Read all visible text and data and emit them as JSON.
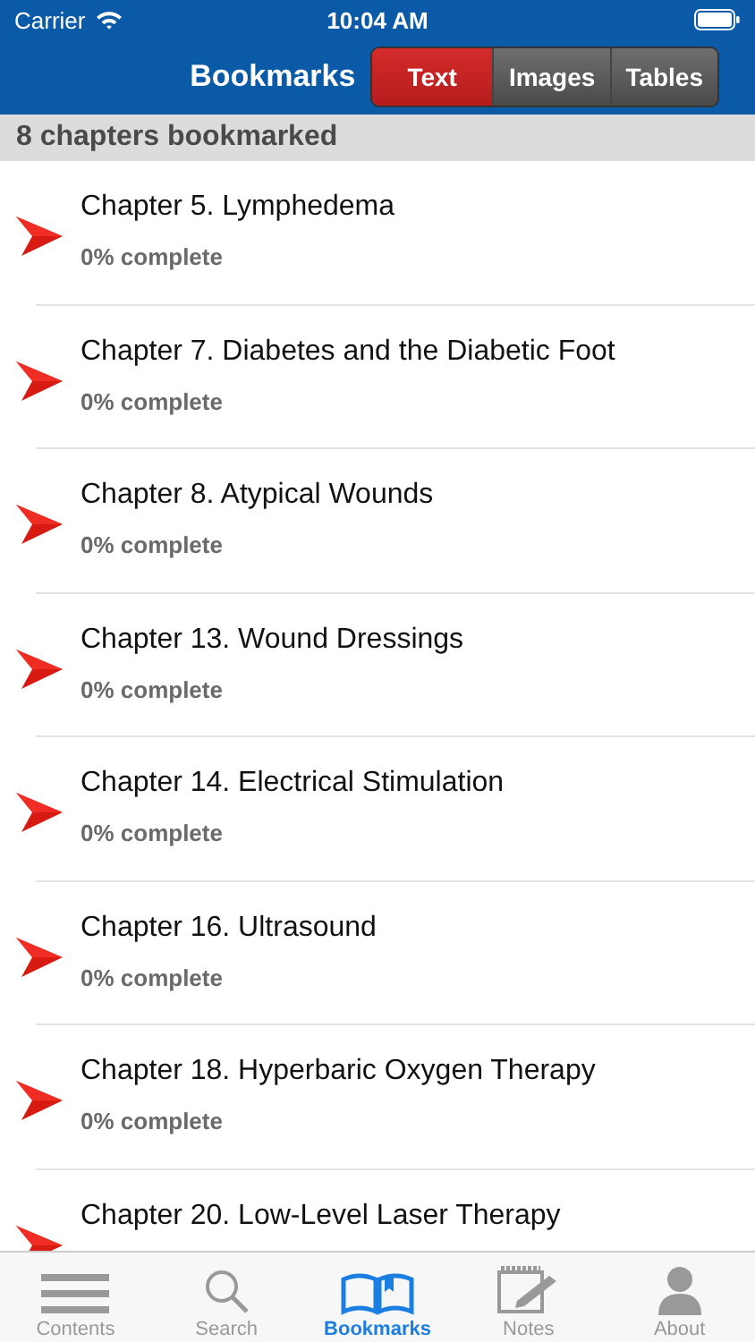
{
  "status_bar": {
    "carrier": "Carrier",
    "time": "10:04 AM"
  },
  "nav": {
    "title": "Bookmarks",
    "segments": [
      {
        "label": "Text",
        "selected": true
      },
      {
        "label": "Images",
        "selected": false
      },
      {
        "label": "Tables",
        "selected": false
      }
    ]
  },
  "header": "8 chapters bookmarked",
  "chapters": [
    {
      "title": "Chapter 5. Lymphedema",
      "progress": "0% complete"
    },
    {
      "title": "Chapter 7. Diabetes and the Diabetic Foot",
      "progress": "0% complete"
    },
    {
      "title": "Chapter 8. Atypical Wounds",
      "progress": "0% complete"
    },
    {
      "title": "Chapter 13. Wound Dressings",
      "progress": "0% complete"
    },
    {
      "title": "Chapter 14. Electrical Stimulation",
      "progress": "0% complete"
    },
    {
      "title": "Chapter 16. Ultrasound",
      "progress": "0% complete"
    },
    {
      "title": "Chapter 18. Hyperbaric Oxygen Therapy",
      "progress": "0% complete"
    },
    {
      "title": "Chapter 20. Low-Level Laser Therapy"
    }
  ],
  "tab_bar": [
    {
      "label": "Contents",
      "kind": "contents",
      "selected": false
    },
    {
      "label": "Search",
      "kind": "search",
      "selected": false
    },
    {
      "label": "Bookmarks",
      "kind": "bookmarks",
      "selected": true
    },
    {
      "label": "Notes",
      "kind": "notes",
      "selected": false
    },
    {
      "label": "About",
      "kind": "about",
      "selected": false
    }
  ]
}
